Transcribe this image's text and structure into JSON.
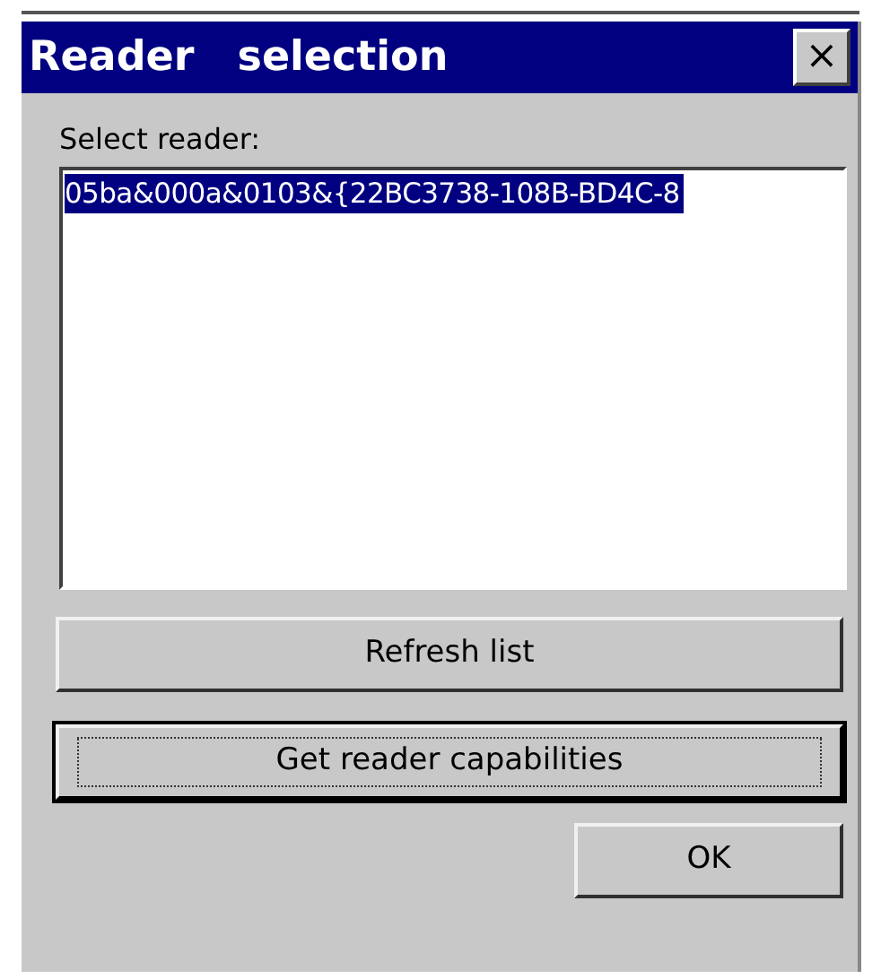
{
  "window": {
    "title": "Reader   selection",
    "close": "×"
  },
  "reader_list": {
    "label": "Select reader:",
    "items": [
      {
        "text": "05ba&000a&0103&{22BC3738-108B-BD4C-8",
        "selected": true
      }
    ]
  },
  "buttons": [
    {
      "label": "Refresh list",
      "focused": false,
      "kind": "wide"
    },
    {
      "label": "Get reader capabilities",
      "focused": true,
      "kind": "wide"
    },
    {
      "label": "OK",
      "focused": false,
      "kind": "small"
    }
  ]
}
